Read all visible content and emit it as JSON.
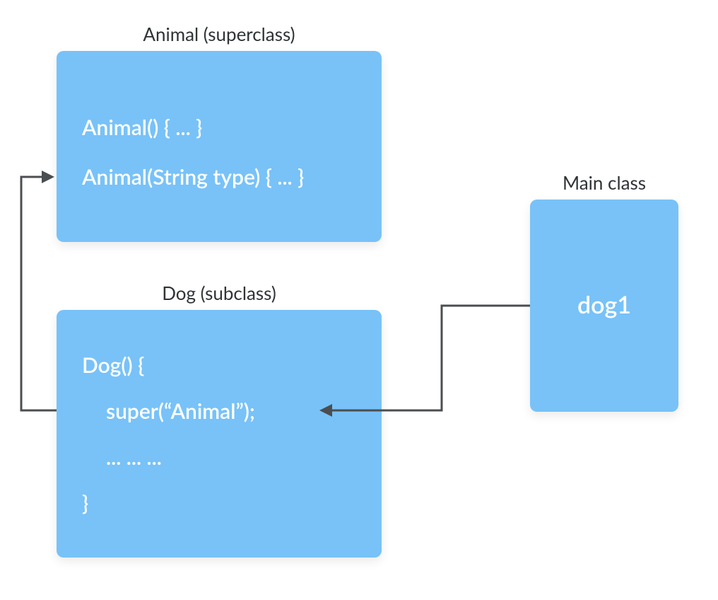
{
  "superclass": {
    "title": "Animal (superclass)",
    "line1": "Animal() { ... }",
    "line2": "Animal(String type) { ... }"
  },
  "subclass": {
    "title": "Dog (subclass)",
    "line1": "Dog() {",
    "line2": "super(“Animal”);",
    "line3": "... ... ...",
    "line4": "}"
  },
  "mainclass": {
    "title": "Main class",
    "object": "dog1"
  },
  "colors": {
    "box_bg": "#78c2f8",
    "text_on_box": "#ffffff",
    "title_text": "#2f3436",
    "arrow": "#4b4e50"
  }
}
